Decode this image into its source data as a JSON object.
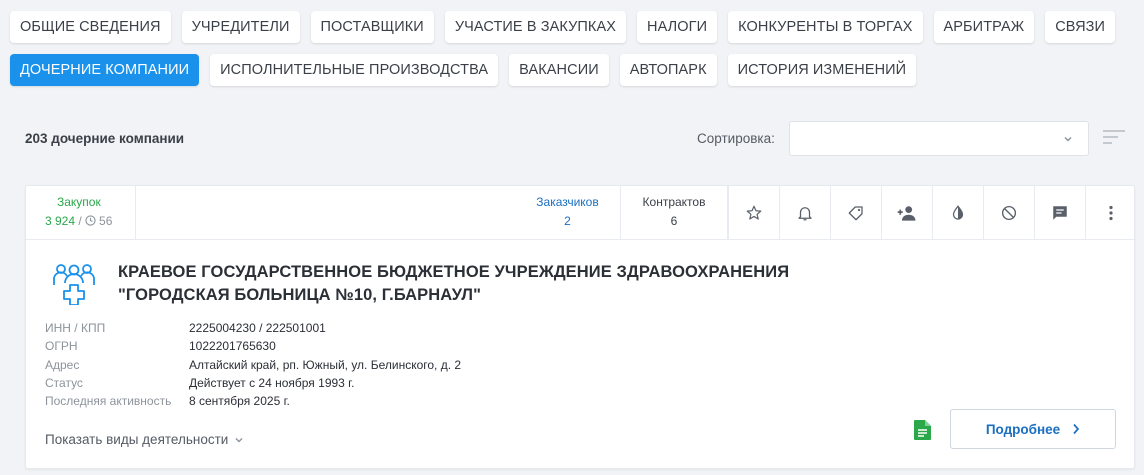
{
  "tabs": {
    "row1": [
      "ОБЩИЕ СВЕДЕНИЯ",
      "УЧРЕДИТЕЛИ",
      "ПОСТАВЩИКИ",
      "УЧАСТИЕ В ЗАКУПКАХ",
      "НАЛОГИ",
      "КОНКУРЕНТЫ В ТОРГАХ",
      "АРБИТРАЖ",
      "СВЯЗИ"
    ],
    "row2": [
      "ДОЧЕРНИЕ КОМПАНИИ",
      "ИСПОЛНИТЕЛЬНЫЕ ПРОИЗВОДСТВА",
      "ВАКАНСИИ",
      "АВТОПАРК",
      "ИСТОРИЯ ИЗМЕНЕНИЙ"
    ],
    "active": "ДОЧЕРНИЕ КОМПАНИИ"
  },
  "summary": "203 дочерние компании",
  "sort": {
    "label": "Сортировка:",
    "value": ""
  },
  "card": {
    "stats": {
      "purchases_label": "Закупок",
      "purchases_value": "3 924",
      "purchases_sep": " / ",
      "purchases_secondary": "56",
      "customers_label": "Заказчиков",
      "customers_value": "2",
      "contracts_label": "Контрактов",
      "contracts_value": "6"
    },
    "actions": [
      "star-icon",
      "bell-icon",
      "tag-icon",
      "person-add-icon",
      "contrast-icon",
      "block-icon",
      "comment-icon",
      "more-vert-icon"
    ],
    "org_name": "Краевое государственное бюджетное учреждение здравоохранения \"Городская больница №10, г.Барнаул\"",
    "details": [
      {
        "label": "ИНН / КПП",
        "value": "2225004230 / 222501001"
      },
      {
        "label": "ОГРН",
        "value": "1022201765630"
      },
      {
        "label": "Адрес",
        "value": "Алтайский край, рп. Южный, ул. Белинского, д. 2"
      },
      {
        "label": "Статус",
        "value": "Действует с 24 ноября 1993 г."
      },
      {
        "label": "Последняя активность",
        "value": "8 сентября 2025 г."
      }
    ],
    "show_activities": "Показать виды деятельности",
    "more_button": "Подробнее"
  },
  "colors": {
    "accent": "#1a91eb",
    "green": "#2aa84a",
    "link": "#1a6fc0"
  }
}
